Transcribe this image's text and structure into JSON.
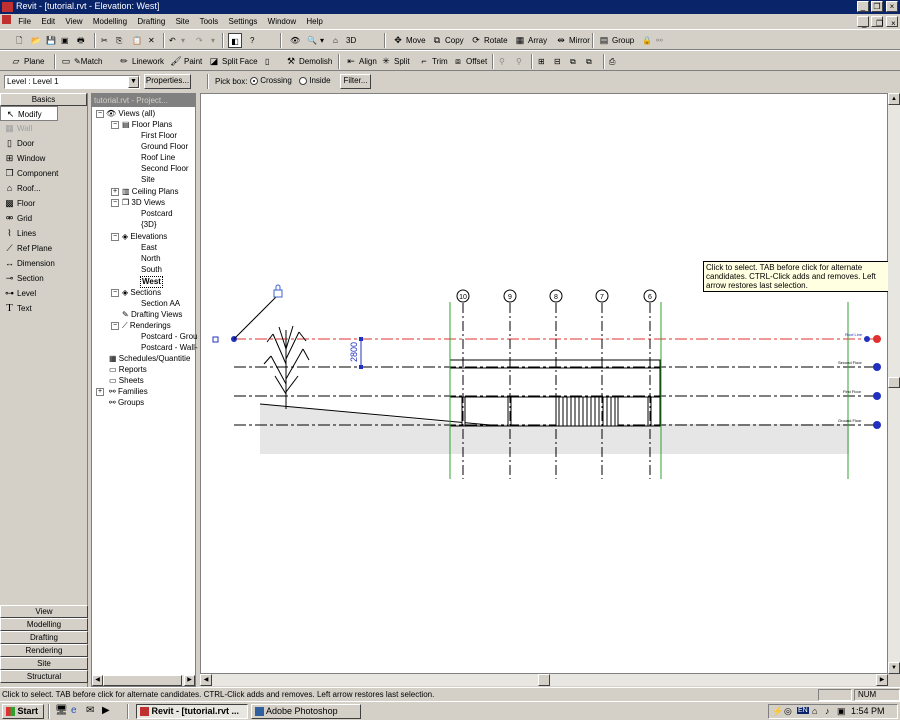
{
  "window": {
    "title": "Revit - [tutorial.rvt - Elevation: West]"
  },
  "menu": [
    "File",
    "Edit",
    "View",
    "Modelling",
    "Drafting",
    "Site",
    "Tools",
    "Settings",
    "Window",
    "Help"
  ],
  "toolbar1": {
    "move": "Move",
    "copy": "Copy",
    "rotate": "Rotate",
    "array": "Array",
    "mirror": "Mirror",
    "group": "Group",
    "view3d": "3D"
  },
  "toolbar2": {
    "plane": "Plane",
    "match": "Match",
    "linework": "Linework",
    "paint": "Paint",
    "split_face": "Split Face",
    "demolish": "Demolish",
    "align": "Align",
    "split": "Split",
    "trim": "Trim",
    "offset": "Offset"
  },
  "options": {
    "level_value": "Level : Level 1",
    "properties": "Properties...",
    "pickbox_label": "Pick box:",
    "crossing": "Crossing",
    "inside": "Inside",
    "filter": "Filter..."
  },
  "design_bar": {
    "header": "Basics",
    "tools": [
      "Modify",
      "Wall",
      "Door",
      "Window",
      "Component",
      "Roof...",
      "Floor",
      "Grid",
      "Lines",
      "Ref Plane",
      "Dimension",
      "Section",
      "Level",
      "Text"
    ],
    "tabs": [
      "View",
      "Modelling",
      "Drafting",
      "Rendering",
      "Site",
      "Structural"
    ]
  },
  "project_browser": {
    "header": "tutorial.rvt - Project...",
    "views_all": "Views (all)",
    "floor_plans": "Floor Plans",
    "floor_plan_items": [
      "First Floor",
      "Ground Floor",
      "Roof Line",
      "Second Floor",
      "Site"
    ],
    "ceiling_plans": "Ceiling Plans",
    "views_3d": "3D Views",
    "views_3d_items": [
      "Postcard",
      "{3D}"
    ],
    "elevations": "Elevations",
    "elevation_items": [
      "East",
      "North",
      "South",
      "West"
    ],
    "sections": "Sections",
    "section_items": [
      "Section AA"
    ],
    "drafting_views": "Drafting Views",
    "renderings": "Renderings",
    "rendering_items": [
      "Postcard - Grou",
      "Postcard - Wall-"
    ],
    "schedules": "Schedules/Quantitie",
    "reports": "Reports",
    "sheets": "Sheets",
    "families": "Families",
    "groups": "Groups"
  },
  "drawing": {
    "dimension": "2800",
    "grids": [
      "10",
      "9",
      "8",
      "7",
      "6"
    ],
    "levels": [
      "Roof Line",
      "Second Floor",
      "First Floor",
      "Ground Floor"
    ]
  },
  "tooltip": "Click to select. TAB before click for alternate candidates. CTRL-Click adds and removes. Left arrow restores last selection.",
  "status": {
    "message": "Click to select. TAB before click for alternate candidates. CTRL-Click adds and removes. Left arrow restores last selection.",
    "num": "NUM"
  },
  "taskbar": {
    "start": "Start",
    "task1": "Revit - [tutorial.rvt ...",
    "task2": "Adobe Photoshop",
    "lang": "EN",
    "clock": "1:54 PM"
  }
}
